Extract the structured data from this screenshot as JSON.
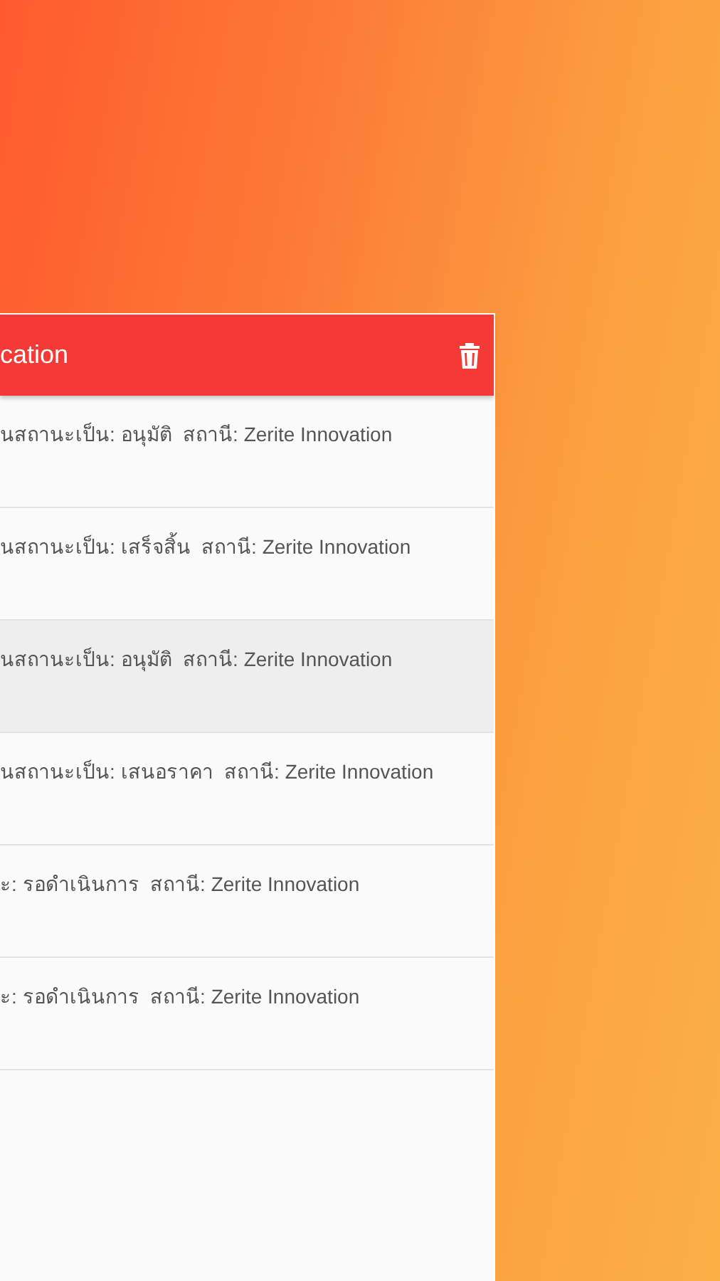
{
  "panel": {
    "title": "cation"
  },
  "items": [
    {
      "text": "นสถานะเป็น: อนุมัติ  สถานี: Zerite Innovation",
      "selected": false
    },
    {
      "text": "นสถานะเป็น: เสร็จสิ้น  สถานี: Zerite Innovation",
      "selected": false
    },
    {
      "text": "นสถานะเป็น: อนุมัติ  สถานี: Zerite Innovation",
      "selected": true
    },
    {
      "text": "นสถานะเป็น: เสนอราคา  สถานี: Zerite Innovation",
      "selected": false
    },
    {
      "text": "ะ: รอดำเนินการ  สถานี: Zerite Innovation",
      "selected": false
    },
    {
      "text": "ะ: รอดำเนินการ  สถานี: Zerite Innovation",
      "selected": false
    }
  ]
}
